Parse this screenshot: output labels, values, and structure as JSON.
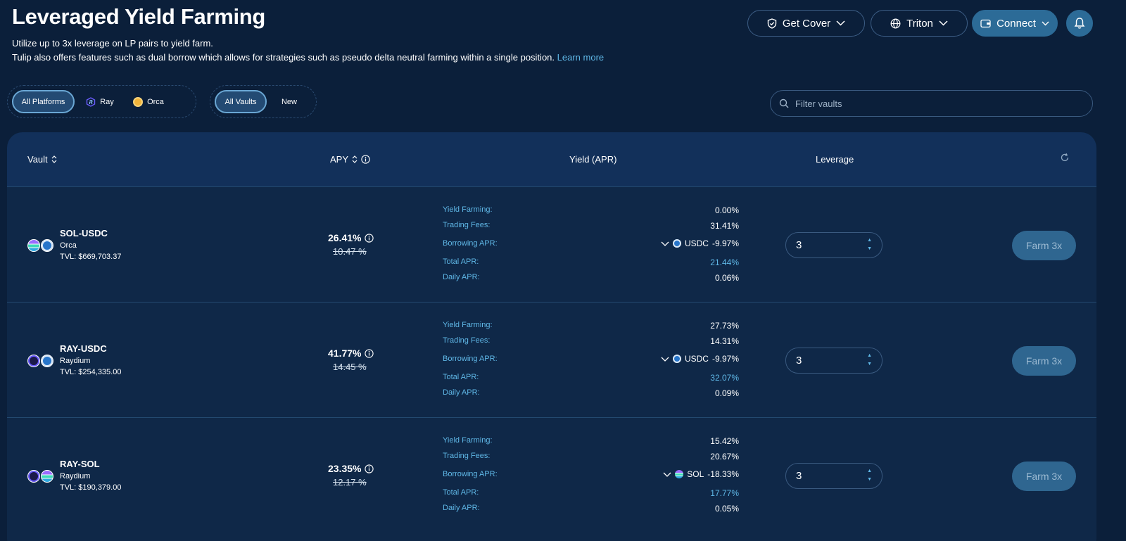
{
  "header": {
    "title": "Leveraged Yield Farming",
    "subtitle1": "Utilize up to 3x leverage on LP pairs to yield farm.",
    "subtitle2": "Tulip also offers features such as dual borrow which allows for strategies such as pseudo delta neutral farming within a single position.",
    "learn_more": "Learn more"
  },
  "topbar": {
    "get_cover": "Get Cover",
    "triton": "Triton",
    "connect": "Connect"
  },
  "filters": {
    "platforms": [
      "All Platforms",
      "Ray",
      "Orca"
    ],
    "vaults": [
      "All Vaults",
      "New"
    ],
    "search_placeholder": "Filter vaults"
  },
  "table": {
    "headers": {
      "vault": "Vault",
      "apy": "APY",
      "yield": "Yield (APR)",
      "leverage": "Leverage"
    },
    "labels": {
      "yield_farming": "Yield Farming:",
      "trading_fees": "Trading Fees:",
      "borrowing_apr": "Borrowing APR:",
      "total_apr": "Total APR:",
      "daily_apr": "Daily APR:"
    },
    "rows": [
      {
        "name": "SOL-USDC",
        "platform": "Orca",
        "tvl": "TVL: $669,703.37",
        "apy": "26.41%",
        "apy_old": "10.47 %",
        "yield_farming": "0.00%",
        "trading_fees": "31.41%",
        "borrow_token": "USDC",
        "borrow_apr": "-9.97%",
        "total_apr": "21.44%",
        "daily_apr": "0.06%",
        "leverage": "3",
        "farm_button": "Farm 3x"
      },
      {
        "name": "RAY-USDC",
        "platform": "Raydium",
        "tvl": "TVL: $254,335.00",
        "apy": "41.77%",
        "apy_old": "14.45 %",
        "yield_farming": "27.73%",
        "trading_fees": "14.31%",
        "borrow_token": "USDC",
        "borrow_apr": "-9.97%",
        "total_apr": "32.07%",
        "daily_apr": "0.09%",
        "leverage": "3",
        "farm_button": "Farm 3x"
      },
      {
        "name": "RAY-SOL",
        "platform": "Raydium",
        "tvl": "TVL: $190,379.00",
        "apy": "23.35%",
        "apy_old": "12.17 %",
        "yield_farming": "15.42%",
        "trading_fees": "20.67%",
        "borrow_token": "SOL",
        "borrow_apr": "-18.33%",
        "total_apr": "17.77%",
        "daily_apr": "0.05%",
        "leverage": "3",
        "farm_button": "Farm 3x"
      }
    ]
  },
  "colors": {
    "background": "#0b1f3a",
    "accent": "#5fb7e6",
    "button": "#2f6690"
  }
}
